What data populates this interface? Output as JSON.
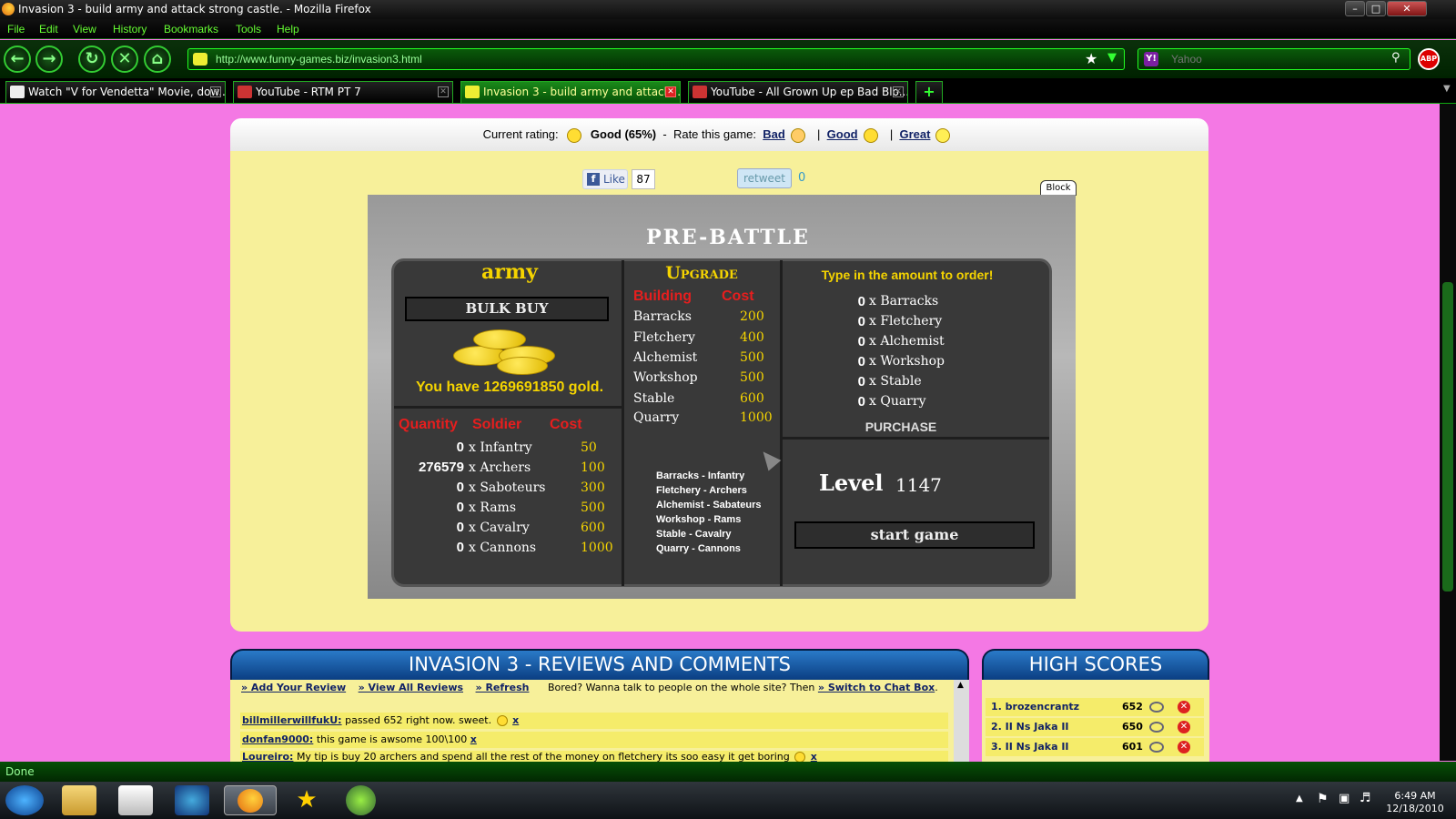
{
  "window": {
    "title": "Invasion 3 - build army and attack strong castle. - Mozilla Firefox",
    "controls": [
      "–",
      "□",
      "✕"
    ]
  },
  "menu": [
    "File",
    "Edit",
    "View",
    "History",
    "Bookmarks",
    "Tools",
    "Help"
  ],
  "navbar": {
    "url": "http://www.funny-games.biz/invasion3.html",
    "search_engine": "Yahoo",
    "abp": "ABP"
  },
  "tabs": [
    {
      "label": "Watch \"V for Vendetta\" Movie, dow...",
      "active": false
    },
    {
      "label": "YouTube - RTM PT 7",
      "active": false
    },
    {
      "label": "Invasion 3 - build army and attack...",
      "active": true
    },
    {
      "label": "YouTube - All Grown Up ep Bad Blo...",
      "active": false
    }
  ],
  "new_tab": "+",
  "rating": {
    "current_label": "Current rating:",
    "current_value": "Good (65%)",
    "sep": "-",
    "rate_label": "Rate this game:",
    "options": [
      "Bad",
      "Good",
      "Great"
    ],
    "divider": "|"
  },
  "social": {
    "like": "Like",
    "like_count": "87",
    "retweet": "retweet",
    "retweet_count": "0",
    "block": "Block"
  },
  "game": {
    "title": "PRE-BATTLE",
    "army": {
      "heading": "army",
      "bulk_buy": "BULK BUY",
      "gold_text": "You have 1269691850 gold.",
      "headers": [
        "Quantity",
        "Soldier",
        "Cost"
      ],
      "rows": [
        {
          "qty": "0",
          "name": "x Infantry",
          "cost": "50"
        },
        {
          "qty": "276579",
          "name": "x Archers",
          "cost": "100"
        },
        {
          "qty": "0",
          "name": "x Saboteurs",
          "cost": "300"
        },
        {
          "qty": "0",
          "name": "x Rams",
          "cost": "500"
        },
        {
          "qty": "0",
          "name": "x Cavalry",
          "cost": "600"
        },
        {
          "qty": "0",
          "name": "x Cannons",
          "cost": "1000"
        }
      ]
    },
    "upgrade": {
      "heading": "Upgrade",
      "headers": [
        "Building",
        "Cost"
      ],
      "rows": [
        {
          "name": "Barracks",
          "cost": "200"
        },
        {
          "name": "Fletchery",
          "cost": "400"
        },
        {
          "name": "Alchemist",
          "cost": "500"
        },
        {
          "name": "Workshop",
          "cost": "500"
        },
        {
          "name": "Stable",
          "cost": "600"
        },
        {
          "name": "Quarry",
          "cost": "1000"
        }
      ],
      "mapping": [
        "Barracks - Infantry",
        "Fletchery - Archers",
        "Alchemist - Sabateurs",
        "Workshop - Rams",
        "Stable - Cavalry",
        "Quarry - Cannons"
      ]
    },
    "order": {
      "heading": "Type in the amount to order!",
      "rows": [
        {
          "qty": "0",
          "name": "x Barracks"
        },
        {
          "qty": "0",
          "name": "x Fletchery"
        },
        {
          "qty": "0",
          "name": "x Alchemist"
        },
        {
          "qty": "0",
          "name": "x Workshop"
        },
        {
          "qty": "0",
          "name": "x Stable"
        },
        {
          "qty": "0",
          "name": "x Quarry"
        }
      ],
      "purchase": "PURCHASE",
      "level_label": "Level",
      "level_value": "1147",
      "start_game": "start game"
    }
  },
  "reviews": {
    "heading": "INVASION 3 - REVIEWS AND COMMENTS",
    "links": [
      "» Add Your Review",
      "» View All Reviews",
      "» Refresh"
    ],
    "chat_text": "Bored? Wanna talk to people on the whole site? Then",
    "chat_link": "» Switch to Chat Box",
    "chat_end": ".",
    "items": [
      {
        "user": "billmillerwillfukU:",
        "text": "passed 652 right now. sweet."
      },
      {
        "user": "donfan9000:",
        "text": "this game is awsome 100\\100"
      },
      {
        "user": "Loureiro:",
        "text": "My tip is buy 20 archers and spend all the rest of the money on fletchery its soo easy it get boring"
      }
    ],
    "x": "x"
  },
  "high_scores": {
    "heading": "HIGH SCORES",
    "rows": [
      {
        "name": "1. brozencrantz",
        "score": "652"
      },
      {
        "name": "2. II Ns Jaka II",
        "score": "650"
      },
      {
        "name": "3. II Ns Jaka II",
        "score": "601"
      }
    ]
  },
  "status": "Done",
  "clock": {
    "time": "6:49 AM",
    "date": "12/18/2010"
  }
}
